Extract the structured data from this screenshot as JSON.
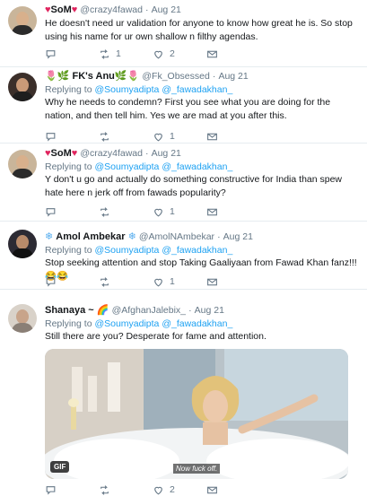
{
  "colors": {
    "link": "#1da1f2",
    "muted": "#657786",
    "heart": "#e0245e",
    "divider": "#e6ecf0"
  },
  "tweets": [
    {
      "name": "SoM",
      "name_prefix_emoji": "♥",
      "name_suffix_emoji": "♥",
      "handle": "@crazy4fawad",
      "time": "Aug 21",
      "reply_to": "",
      "text": "He doesn't need ur validation for anyone to know how great he is. So stop using his name for ur own shallow n filthy agendas.",
      "reply_count": "",
      "retweet_count": "1",
      "like_count": "2"
    },
    {
      "name": "FK's Anu",
      "name_prefix_emoji": "🌷🌿",
      "name_suffix_emoji": "🌿🌷",
      "handle": "@Fk_Obsessed",
      "time": "Aug 21",
      "reply_label": "Replying to",
      "reply_to": "@Soumyadipta @_fawadakhan_",
      "text": "Why he needs to condemn? First you see what you are doing for the nation, and then tell him. Yes we are mad at you after this.",
      "reply_count": "",
      "retweet_count": "",
      "like_count": "1"
    },
    {
      "name": "SoM",
      "name_prefix_emoji": "♥",
      "name_suffix_emoji": "♥",
      "handle": "@crazy4fawad",
      "time": "Aug 21",
      "reply_label": "Replying to",
      "reply_to": "@Soumyadipta @_fawadakhan_",
      "text": "Y don't u go and actually do something constructive for India than spew hate here n jerk off from fawads popularity?",
      "reply_count": "",
      "retweet_count": "",
      "like_count": "1"
    },
    {
      "name": "Amol Ambekar",
      "name_prefix_emoji": "❄",
      "name_suffix_emoji": "❄",
      "handle": "@AmolNAmbekar",
      "time": "Aug 21",
      "reply_label": "Replying to",
      "reply_to": "@Soumyadipta @_fawadakhan_",
      "text": "Stop seeking attention and stop Taking Gaaliyaan from Fawad Khan fanz!!! 😂😂",
      "reply_count": "",
      "retweet_count": "",
      "like_count": "1"
    },
    {
      "name": "Shanaya ~",
      "name_prefix_emoji": "",
      "name_suffix_emoji": "🌈",
      "handle": "@AfghanJalebix_",
      "time": "Aug 21",
      "reply_label": "Replying to",
      "reply_to": "@Soumyadipta @_fawadakhan_",
      "text": "Still there are you? Desperate for fame and attention.",
      "media_badge": "GIF",
      "media_caption": "Now fuck off.",
      "reply_count": "",
      "retweet_count": "",
      "like_count": "2"
    }
  ]
}
